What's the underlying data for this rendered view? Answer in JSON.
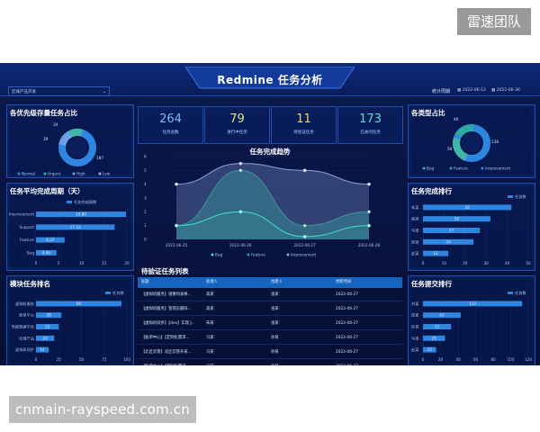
{
  "watermarks": {
    "top": "雷速团队",
    "bottom": "cnmain-rayspeed.com.cn"
  },
  "header": {
    "title": "Redmine 任务分析",
    "dropdown_value": "区域产品开发",
    "period_label": "统计周期",
    "date_start": "2022-06-12",
    "date_end": "2022-06-30"
  },
  "colors": {
    "accent": "#2f86e0",
    "cyan": "#37d6d1",
    "teal": "#3fb6a8",
    "yellow": "#e4d65a",
    "lightblue": "#6aa9ff"
  },
  "stats": [
    {
      "value": "264",
      "label": "任务总数",
      "color": "#7fb8ff"
    },
    {
      "value": "79",
      "label": "进行中任务",
      "color": "#d8e87a"
    },
    {
      "value": "11",
      "label": "待验证任务",
      "color": "#f0d95a"
    },
    {
      "value": "173",
      "label": "已关闭任务",
      "color": "#6cd6c6"
    }
  ],
  "priority_panel": {
    "title": "各优先级存量任务占比",
    "labels": [
      "34",
      "39",
      "187"
    ],
    "legend": [
      "Normal",
      "Urgent",
      "High",
      "Low"
    ],
    "legend_icons": [
      "dot-icon",
      "dot-icon",
      "dot-icon",
      "dot-icon"
    ]
  },
  "type_panel": {
    "title": "各类型占比",
    "labels": [
      "46",
      "56",
      "138"
    ],
    "legend": [
      "Bug",
      "Feature",
      "Improvement"
    ]
  },
  "cycle_panel": {
    "title": "任务平均完成周期（天）",
    "legend": "任务完成周期",
    "chart_data": {
      "type": "bar",
      "categories": [
        "Improvement",
        "Support",
        "Feature",
        "Bug"
      ],
      "values": [
        19.8,
        17.3,
        6.3,
        4.5
      ],
      "value_labels": [
        "19.80",
        "17.33",
        "6.37",
        "4.46"
      ],
      "xlim": [
        0,
        20
      ],
      "xticks": [
        "0",
        "5",
        "10",
        "15",
        "20"
      ]
    }
  },
  "module_panel": {
    "title": "模块任务排名",
    "legend": "任务数",
    "chart_data": {
      "type": "bar",
      "categories": [
        "虚拟机服务",
        "账单中心",
        "性能数据平台",
        "区域产品",
        "虚拟机同步"
      ],
      "values": [
        94,
        28,
        25,
        20,
        14
      ],
      "value_labels": [
        "94",
        "28",
        "25",
        "20",
        "14"
      ],
      "xlim": [
        0,
        100
      ],
      "xticks": [
        "0",
        "25",
        "50",
        "75",
        "100"
      ]
    }
  },
  "trend_panel": {
    "title": "任务完成趋势",
    "chart_data": {
      "type": "line",
      "x": [
        "2022-06-25",
        "2022-06-26",
        "2022-06-27",
        "2022-06-28"
      ],
      "series": [
        {
          "name": "Bug",
          "values": [
            1,
            2,
            0.2,
            1
          ],
          "color": "#3fe0d0"
        },
        {
          "name": "Feature",
          "values": [
            1,
            5,
            1,
            2
          ],
          "color": "#3a9a9a"
        },
        {
          "name": "Improvement",
          "values": [
            4,
            5.5,
            5,
            4
          ],
          "color": "#8aa4d6"
        }
      ],
      "ylim": [
        0,
        6
      ],
      "yticks": [
        "0",
        "1",
        "2",
        "3",
        "4",
        "5",
        "6"
      ]
    }
  },
  "ranking_panel": {
    "title": "任务完成排行",
    "legend": "任务数",
    "chart_data": {
      "type": "bar",
      "categories": [
        "朱某",
        "高某",
        "马某",
        "郭某",
        "赵某"
      ],
      "values": [
        42,
        32,
        27,
        24,
        12
      ],
      "value_labels": [
        "42",
        "32",
        "27",
        "24",
        "12"
      ],
      "xlim": [
        0,
        50
      ],
      "xticks": [
        "0",
        "10",
        "20",
        "30",
        "40",
        "50"
      ]
    }
  },
  "submit_panel": {
    "title": "任务提交排行",
    "legend": "任务数",
    "chart_data": {
      "type": "bar",
      "categories": [
        "刘某",
        "田某",
        "孙某",
        "马某",
        "赵某"
      ],
      "values": [
        113,
        43,
        32,
        25,
        15
      ],
      "value_labels": [
        "113",
        "43",
        "32",
        "25",
        "15"
      ],
      "xlim": [
        0,
        120
      ],
      "xticks": [
        "0",
        "20",
        "40",
        "60",
        "80",
        "100",
        "120"
      ]
    }
  },
  "pending_table": {
    "title": "待验证任务列表",
    "columns": [
      "标题",
      "处理人",
      "创建人",
      "更新时间"
    ],
    "rows": [
      [
        "【虚拟机服务】镜像列表根...",
        "高某",
        "张某",
        "2022-06-27"
      ],
      [
        "【虚拟机服务】管理员删除...",
        "高某",
        "张某",
        "2022-06-27"
      ],
      [
        "【虚拟机同步】【dev】实现 J...",
        "朱某",
        "张某",
        "2022-06-27"
      ],
      [
        "【账单中心】【定制化需求...",
        "马某",
        "孙某",
        "2022-06-27"
      ],
      [
        "【北区云管】北区云管开发...",
        "马某",
        "孙某",
        "2022-06-27"
      ],
      [
        "【账单中心】【定制化需求...",
        "马某",
        "孙某",
        "2022-06-27"
      ]
    ]
  }
}
